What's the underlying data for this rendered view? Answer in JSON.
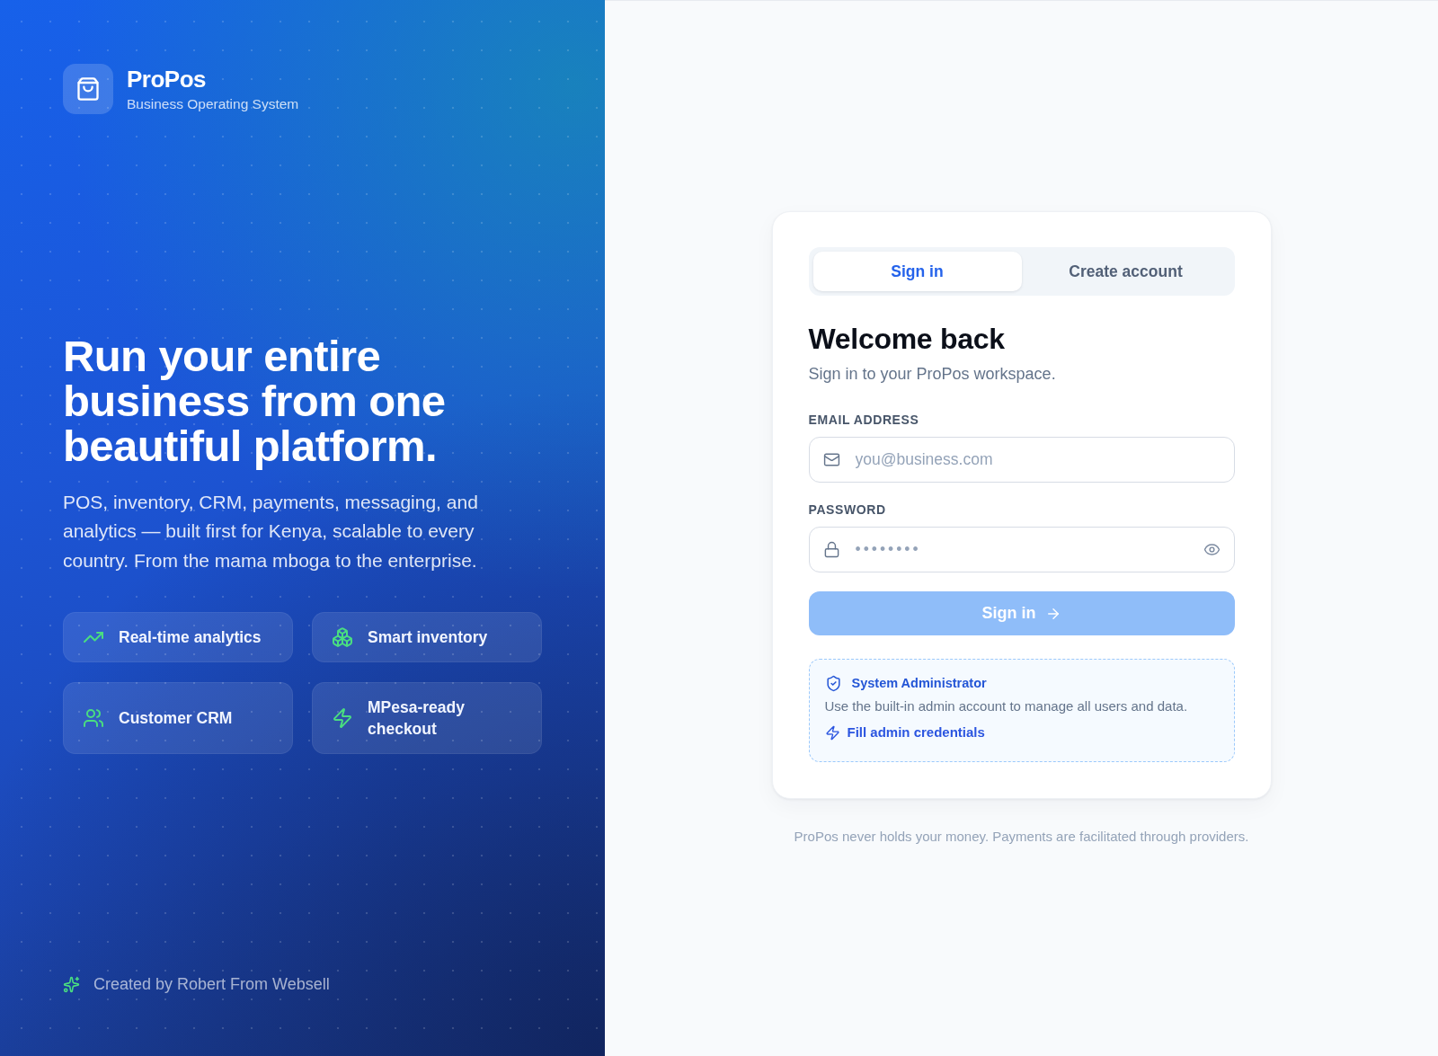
{
  "brand": {
    "name": "ProPos",
    "tagline": "Business Operating System"
  },
  "hero": {
    "headline": "Run your entire business from one beautiful platform.",
    "description": "POS, inventory, CRM, payments, messaging, and analytics — built first for Kenya, scalable to every country. From the mama mboga to the enterprise."
  },
  "feature_rows": [
    {
      "cards": [
        {
          "label": "Real-time analytics"
        },
        {
          "label": "Smart inventory"
        }
      ]
    },
    {
      "cards": [
        {
          "label": "Customer CRM"
        },
        {
          "label": "MPesa-ready checkout"
        }
      ]
    }
  ],
  "credit": "Created by Robert From Websell",
  "auth_tabs": [
    {
      "label": "Sign in",
      "selected": true
    },
    {
      "label": "Create account",
      "selected": false
    }
  ],
  "form": {
    "title": "Welcome back",
    "subtitle": "Sign in to your ProPos workspace.",
    "fields": [
      {
        "kind": "email",
        "label": "EMAIL ADDRESS",
        "placeholder": "you@business.com"
      },
      {
        "kind": "password",
        "label": "PASSWORD",
        "placeholder": "••••••••"
      }
    ],
    "submit": {
      "label": "Sign in",
      "disabled": true
    }
  },
  "admin_hint": {
    "title": "System Administrator",
    "description": "Use the built-in admin account to manage all users and data.",
    "action": "Fill admin credentials"
  },
  "footnote": "ProPos never holds your money. Payments are facilitated through providers."
}
